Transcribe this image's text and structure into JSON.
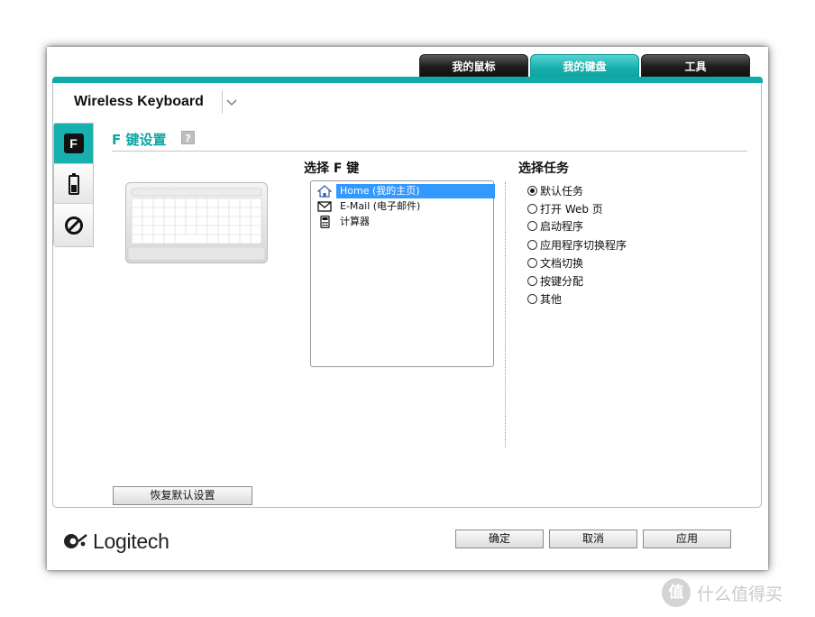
{
  "tabs": [
    {
      "label": "我的鼠标",
      "active": false
    },
    {
      "label": "我的键盘",
      "active": true
    },
    {
      "label": "工具",
      "active": false
    }
  ],
  "device": {
    "name": "Wireless Keyboard"
  },
  "side_tabs": [
    {
      "label": "F",
      "icon": "f-key-icon",
      "active": true
    },
    {
      "icon": "battery-icon",
      "active": false
    },
    {
      "icon": "disable-icon",
      "active": false
    }
  ],
  "section": {
    "title": "F 键设置",
    "help": "?"
  },
  "select_key": {
    "title": "选择 F 键",
    "items": [
      {
        "icon": "home-icon",
        "label": "Home (我的主页)",
        "selected": true
      },
      {
        "icon": "mail-icon",
        "label": "E-Mail (电子邮件)",
        "selected": false
      },
      {
        "icon": "calculator-icon",
        "label": "计算器",
        "selected": false
      }
    ]
  },
  "select_task": {
    "title": "选择任务",
    "options": [
      {
        "label": "默认任务",
        "checked": true
      },
      {
        "label": "打开 Web 页",
        "checked": false
      },
      {
        "label": "启动程序",
        "checked": false
      },
      {
        "label": "应用程序切换程序",
        "checked": false
      },
      {
        "label": "文档切换",
        "checked": false
      },
      {
        "label": "按键分配",
        "checked": false
      },
      {
        "label": "其他",
        "checked": false
      }
    ]
  },
  "buttons": {
    "restore": "恢复默认设置",
    "ok": "确定",
    "cancel": "取消",
    "apply": "应用"
  },
  "brand": {
    "logo": "Logitech"
  },
  "watermark": {
    "symbol": "值",
    "text": "什么值得买"
  },
  "colors": {
    "accent": "#10aaa8",
    "selection": "#3399ff"
  }
}
